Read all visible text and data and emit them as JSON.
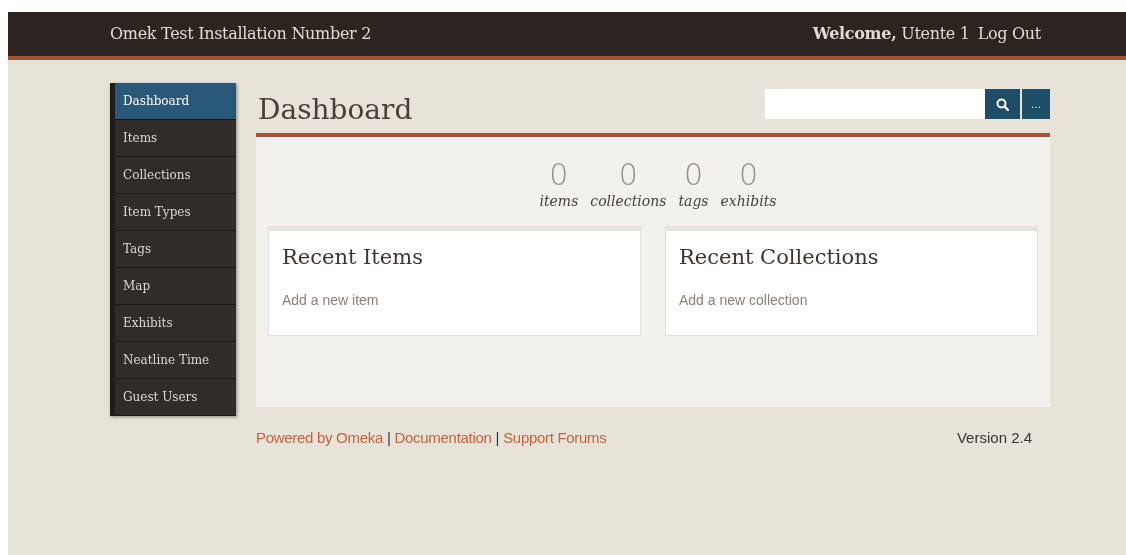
{
  "header": {
    "site_title": "Omek Test Installation Number 2",
    "welcome": "**Welcome,** Utente 1",
    "logout": "Log Out"
  },
  "sidebar": {
    "items": [
      {
        "label": "Dashboard",
        "selected": true
      },
      {
        "label": "Items",
        "selected": false
      },
      {
        "label": "Collections",
        "selected": false
      },
      {
        "label": "Item Types",
        "selected": false
      },
      {
        "label": "Tags",
        "selected": false
      },
      {
        "label": "Map",
        "selected": false
      },
      {
        "label": "Exhibits",
        "selected": false
      },
      {
        "label": "Neatline Time",
        "selected": false
      },
      {
        "label": "Guest Users",
        "selected": false
      }
    ]
  },
  "page_title": "Dashboard",
  "search": {
    "more_button": "…"
  },
  "stats": [
    {
      "count": "0",
      "label": "items"
    },
    {
      "count": "0",
      "label": "collections"
    },
    {
      "count": "0",
      "label": "tags"
    },
    {
      "count": "0",
      "label": "exhibits"
    }
  ],
  "cards": [
    {
      "title": "Recent Items",
      "link": "Add a new item"
    },
    {
      "title": "Recent Collections",
      "link": "Add a new collection"
    }
  ],
  "footer": {
    "items": [
      {
        "kind": "link",
        "text": "Powered by Omeka"
      },
      {
        "kind": "separator",
        "text": "|"
      },
      {
        "kind": "link",
        "text": "Documentation"
      },
      {
        "kind": "separator",
        "text": "|"
      },
      {
        "kind": "link",
        "text": "Support Forums"
      }
    ],
    "version": "Version 2.4"
  }
}
